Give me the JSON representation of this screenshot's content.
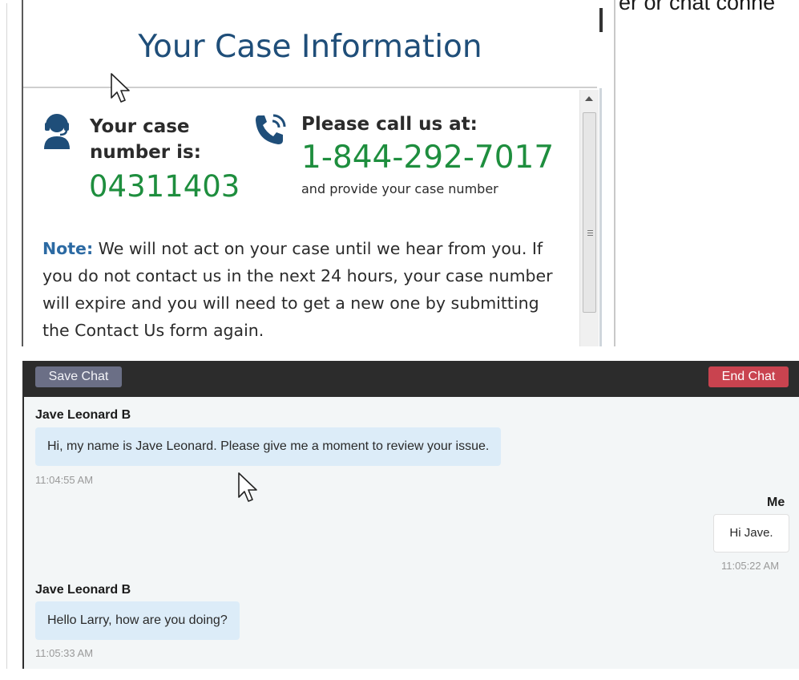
{
  "background_text": "er or chat conne",
  "case_window": {
    "title": "Your Case Information",
    "case_number_label": "Your case number is:",
    "case_number": "04311403",
    "call_label": "Please call us at:",
    "phone_number": "1-844-292-7017",
    "call_subtext": "and provide your case number",
    "note_label": "Note:",
    "note_text": " We will not act on your case until we hear from you. If you do not contact us in the next 24 hours, your case number will expire and you will need to get a new one by submitting the Contact Us form again."
  },
  "chat": {
    "save_button": "Save Chat",
    "end_button": "End Chat",
    "messages": [
      {
        "sender": "Jave Leonard B",
        "text": "Hi, my name is Jave Leonard. Please give me a moment to review your issue.",
        "time": "11:04:55 AM"
      },
      {
        "sender": "Me",
        "text": "Hi Jave.",
        "time": "11:05:22 AM"
      },
      {
        "sender": "Jave Leonard B",
        "text": "Hello Larry, how are you doing?",
        "time": "11:05:33 AM"
      }
    ]
  },
  "colors": {
    "title_blue": "#1f4e79",
    "green": "#1e8e3e",
    "note_blue": "#2c6aa3",
    "save_button": "#6b6f86",
    "end_button": "#c9434f",
    "agent_bubble": "#dcecf8"
  },
  "icons": [
    "agent-headset-icon",
    "phone-call-icon",
    "mouse-cursor-icon"
  ]
}
